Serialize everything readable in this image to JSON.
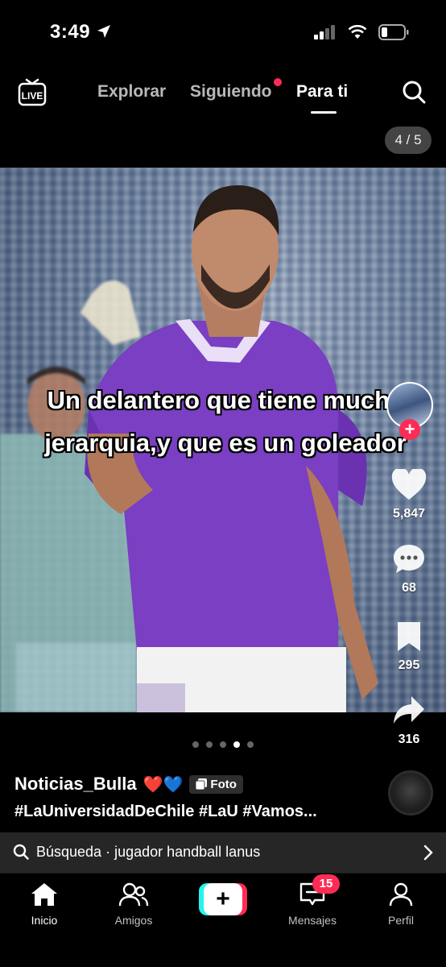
{
  "status_bar": {
    "time": "3:49"
  },
  "top_nav": {
    "live_label": "LIVE",
    "tabs": [
      "Explorar",
      "Siguiendo",
      "Para ti"
    ],
    "active_tab": "Para ti"
  },
  "post": {
    "page_counter": "4 / 5",
    "caption": "Un delantero que tiene mucha jerarquia,y que es un goleador",
    "likes": "5,847",
    "comments": "68",
    "saves": "295",
    "shares": "316",
    "slide_count": 5,
    "active_slide": 4,
    "author": "Noticias_Bulla",
    "author_emojis": "❤️💙",
    "type_badge": "Foto",
    "hashtags": "#LaUniversidadDeChile #LaU #Vamos..."
  },
  "search": {
    "query": "Búsqueda · jugador handball lanus"
  },
  "tab_bar": {
    "items": [
      "Inicio",
      "Amigos",
      "Mensajes",
      "Perfil"
    ],
    "messages_badge": "15",
    "active": "Inicio"
  },
  "colors": {
    "accent": "#fe2c55",
    "cyan": "#25f4ee",
    "jersey": "#7a3fc2"
  }
}
